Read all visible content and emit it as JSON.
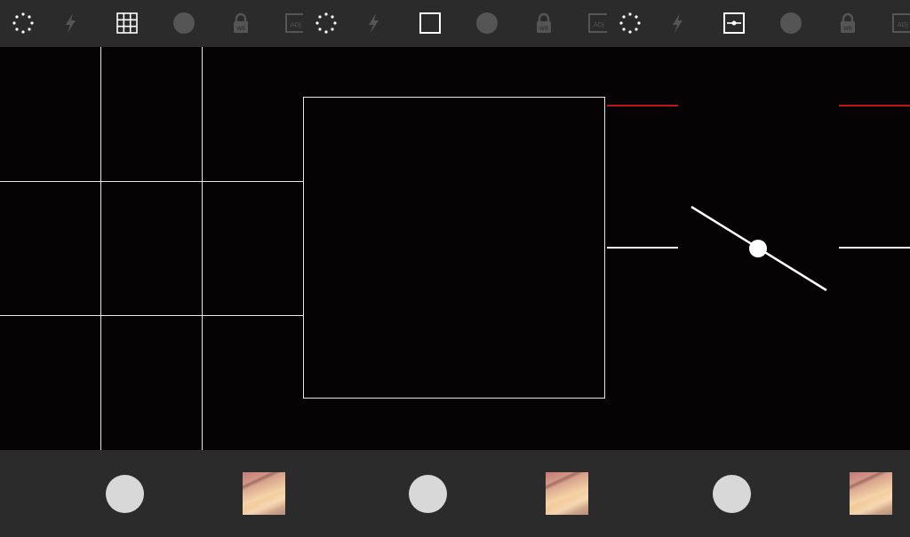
{
  "panels": [
    {
      "id": "grid-mode",
      "toolbar": {
        "icons": [
          {
            "name": "timer-icon",
            "active": true
          },
          {
            "name": "flash-icon",
            "active": false
          },
          {
            "name": "grid-icon",
            "active": true
          },
          {
            "name": "focus-dot-icon",
            "active": false
          },
          {
            "name": "white-balance-lock-icon",
            "active": false
          },
          {
            "name": "adjust-icon",
            "active": false
          }
        ]
      },
      "overlay": "grid-3x3",
      "bottom": {
        "shutter": "shutter-button",
        "thumbnail": "last-photo-thumbnail"
      }
    },
    {
      "id": "square-mode",
      "toolbar": {
        "icons": [
          {
            "name": "timer-icon",
            "active": true
          },
          {
            "name": "flash-icon",
            "active": false
          },
          {
            "name": "square-frame-icon",
            "active": true
          },
          {
            "name": "focus-dot-icon",
            "active": false
          },
          {
            "name": "white-balance-lock-icon",
            "active": false
          },
          {
            "name": "adjust-icon",
            "active": false
          }
        ]
      },
      "overlay": "square-frame",
      "bottom": {
        "shutter": "shutter-button",
        "thumbnail": "last-photo-thumbnail"
      }
    },
    {
      "id": "level-mode",
      "toolbar": {
        "icons": [
          {
            "name": "timer-icon",
            "active": true
          },
          {
            "name": "flash-icon",
            "active": false
          },
          {
            "name": "level-icon",
            "active": true
          },
          {
            "name": "focus-dot-icon",
            "active": false
          },
          {
            "name": "white-balance-lock-icon",
            "active": false
          },
          {
            "name": "adjust-icon",
            "active": false
          }
        ]
      },
      "overlay": "horizon-level",
      "bottom": {
        "shutter": "shutter-button",
        "thumbnail": "last-photo-thumbnail"
      }
    }
  ],
  "colors": {
    "toolbar_bg": "#2b2b2b",
    "viewport_bg": "#050304",
    "active_icon": "#ffffff",
    "inactive_icon": "#555555",
    "shutter": "#d8d8d8",
    "level_reference": "#c0141a"
  }
}
